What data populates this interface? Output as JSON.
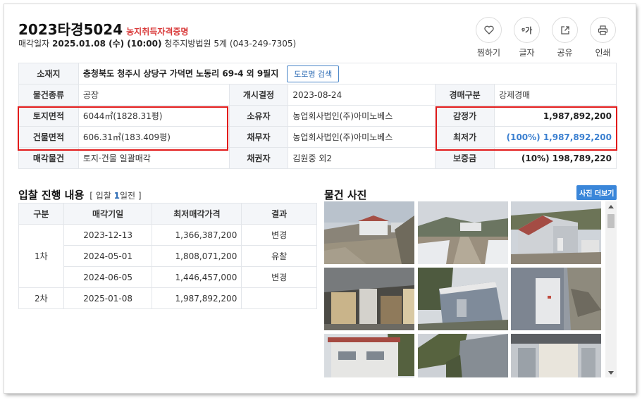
{
  "header": {
    "case_number": "2023타경5024",
    "tag": "농지취득자격증명",
    "sale_label": "매각일자",
    "sale_date": "2025.01.08 (수) (10:00)",
    "court": "청주지방법원 5계 (043-249-7305)"
  },
  "actions": [
    {
      "label": "찜하기",
      "icon": "heart-icon"
    },
    {
      "label": "글자",
      "icon": "font-size-icon",
      "glyph": "ᵍ가"
    },
    {
      "label": "공유",
      "icon": "share-icon"
    },
    {
      "label": "인쇄",
      "icon": "print-icon"
    }
  ],
  "info": {
    "location_label": "소재지",
    "location": "충청북도 청주시 상당구 가덕면 노동리 69-4 외 9필지",
    "road_button": "도로명 검색",
    "type_label": "물건종류",
    "type": "공장",
    "start_label": "개시결정",
    "start": "2023-08-24",
    "auction_type_label": "경매구분",
    "auction_type": "강제경매",
    "land_label": "토지면적",
    "land": "6044㎡(1828.31평)",
    "owner_label": "소유자",
    "owner": "농업회사법인(주)아미노베스",
    "appraisal_label": "감정가",
    "appraisal": "1,987,892,200",
    "building_label": "건물면적",
    "building": "606.31㎡(183.409평)",
    "debtor_label": "채무자",
    "debtor": "농업회사법인(주)아미노베스",
    "minimum_label": "최저가",
    "minimum": "(100%) 1,987,892,200",
    "sale_item_label": "매각물건",
    "sale_item": "토지·건물 일괄매각",
    "creditor_label": "채권자",
    "creditor": "김원중 외2",
    "deposit_label": "보증금",
    "deposit": "(10%) 198,789,220"
  },
  "bids": {
    "title": "입찰 진행 내용",
    "note_pre": "[ 입찰 ",
    "note_num": "1",
    "note_post": "일전 ]",
    "columns": [
      "구분",
      "매각기일",
      "최저매각가격",
      "결과"
    ],
    "rows": [
      {
        "round": "",
        "date": "2023-12-13",
        "price": "1,366,387,200",
        "result": "변경"
      },
      {
        "round": "1차",
        "date": "2024-05-01",
        "price": "1,808,071,200",
        "result": "유찰"
      },
      {
        "round": "",
        "date": "2024-06-05",
        "price": "1,446,457,000",
        "result": "변경"
      },
      {
        "round": "2차",
        "date": "2025-01-08",
        "price": "1,987,892,200",
        "result": ""
      }
    ]
  },
  "photos": {
    "title": "물건 사진",
    "more_button": "사진 더보기"
  },
  "colors": {
    "tag_red": "#d93a3a",
    "link_blue": "#2f6db5",
    "highlight_red": "#e21b1b",
    "button_blue": "#3a86d9"
  }
}
